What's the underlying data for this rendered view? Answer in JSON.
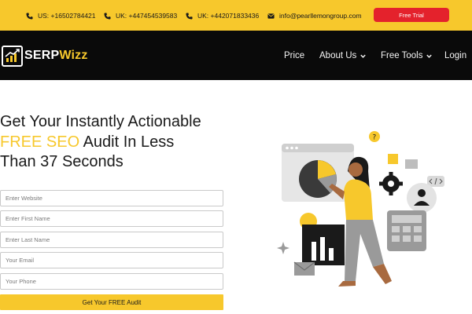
{
  "topbar": {
    "contacts": [
      {
        "icon": "phone-icon",
        "text": "US: +16502784421"
      },
      {
        "icon": "phone-icon",
        "text": "UK: +447454539583"
      },
      {
        "icon": "phone-icon",
        "text": "UK: +442071833436"
      },
      {
        "icon": "email-icon",
        "text": "info@pearllemongroup.com"
      }
    ],
    "trial_label": "Free Trial"
  },
  "nav": {
    "logo_part1": "SERP",
    "logo_part2": "Wizz",
    "items": [
      {
        "label": "Price",
        "dropdown": false
      },
      {
        "label": "About Us",
        "dropdown": true
      },
      {
        "label": "Free Tools",
        "dropdown": true
      },
      {
        "label": "Login",
        "dropdown": false
      }
    ]
  },
  "hero": {
    "title_line1": "Get Your Instantly Actionable",
    "title_highlight": "FREE SEO",
    "title_line2_rest": " Audit In Less",
    "title_line3": "Than 37 Seconds"
  },
  "form": {
    "website_placeholder": "Enter Website",
    "first_name_placeholder": "Enter First Name",
    "last_name_placeholder": "Enter Last Name",
    "email_placeholder": "Your Email",
    "phone_placeholder": "Your Phone",
    "submit_label": "Get Your FREE Audit"
  },
  "colors": {
    "accent": "#f7c82c",
    "trial": "#e4222c",
    "nav_bg": "#0a0a0a"
  }
}
